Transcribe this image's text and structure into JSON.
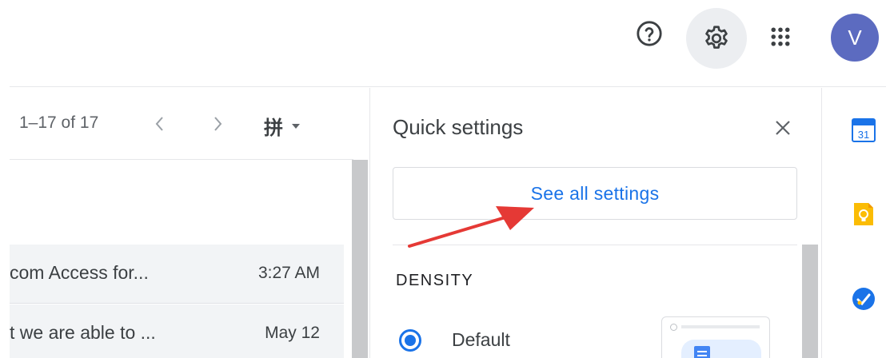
{
  "header": {
    "help_icon": "help-circle-icon",
    "settings_icon": "gear-icon",
    "apps_icon": "apps-grid-icon",
    "avatar_initial": "V",
    "avatar_color": "#5c6bc0"
  },
  "mail_list": {
    "pagination": "1–17 of 17",
    "prev_icon": "chevron-left-icon",
    "next_icon": "chevron-right-icon",
    "input_tools_label": "拼",
    "input_tools_dropdown_icon": "caret-down-icon",
    "rows": [
      {
        "snippet": "com Access for...",
        "time": "3:27 AM"
      },
      {
        "snippet": "t we are able to ...",
        "time": "May 12"
      }
    ]
  },
  "quick_settings": {
    "title": "Quick settings",
    "close_icon": "close-icon",
    "see_all_label": "See all settings",
    "density_heading": "DENSITY",
    "density_option": "Default",
    "density_selected": true
  },
  "side_apps": {
    "calendar_label": "31",
    "calendar_icon": "calendar-icon",
    "keep_icon": "keep-icon",
    "tasks_icon": "tasks-icon"
  },
  "colors": {
    "accent": "#1a73e8",
    "annotation_arrow": "#e53935"
  }
}
